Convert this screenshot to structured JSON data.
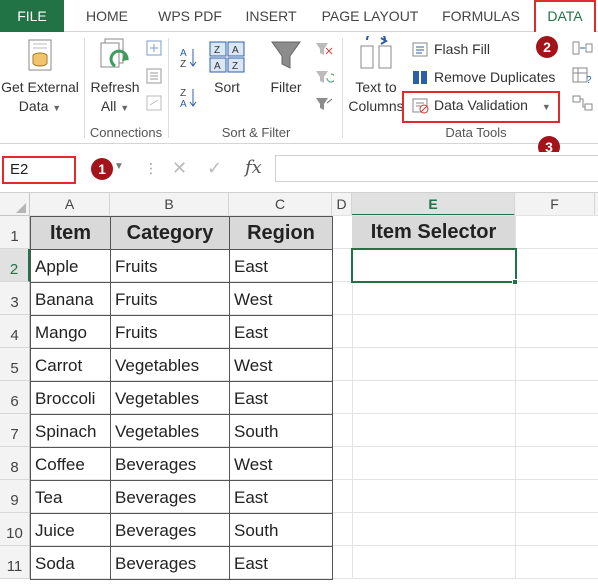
{
  "ribbon_tabs": [
    "FILE",
    "HOME",
    "WPS PDF",
    "INSERT",
    "PAGE LAYOUT",
    "FORMULAS",
    "DATA"
  ],
  "ribbon": {
    "get_external_data": {
      "line1": "Get External",
      "line2": "Data"
    },
    "refresh_all": {
      "line1": "Refresh",
      "line2": "All"
    },
    "connections_label": "Connections",
    "sort_label": "Sort",
    "filter_label": "Filter",
    "sort_filter_label": "Sort & Filter",
    "text_to_columns": {
      "line1": "Text to",
      "line2": "Columns"
    },
    "flash_fill": "Flash Fill",
    "remove_duplicates": "Remove Duplicates",
    "data_validation": "Data Validation",
    "data_tools_label": "Data Tools"
  },
  "markers": [
    "1",
    "2",
    "3"
  ],
  "formula_bar": {
    "name_box": "E2",
    "fx": "fx",
    "formula": ""
  },
  "colors": {
    "accent": "#217346",
    "highlight": "#e02b2b",
    "marker": "#a3141a"
  },
  "columns": [
    "A",
    "B",
    "C",
    "D",
    "E",
    "F"
  ],
  "active_column": "E",
  "active_row": "2",
  "rows": [
    "1",
    "2",
    "3",
    "4",
    "5",
    "6",
    "7",
    "8",
    "9",
    "10",
    "11"
  ],
  "table": {
    "headers": [
      "Item",
      "Category",
      "Region"
    ],
    "rows": [
      [
        "Apple",
        "Fruits",
        "East"
      ],
      [
        "Banana",
        "Fruits",
        "West"
      ],
      [
        "Mango",
        "Fruits",
        "East"
      ],
      [
        "Carrot",
        "Vegetables",
        "West"
      ],
      [
        "Broccoli",
        "Vegetables",
        "East"
      ],
      [
        "Spinach",
        "Vegetables",
        "South"
      ],
      [
        "Coffee",
        "Beverages",
        "West"
      ],
      [
        "Tea",
        "Beverages",
        "East"
      ],
      [
        "Juice",
        "Beverages",
        "South"
      ],
      [
        "Soda",
        "Beverages",
        "East"
      ]
    ]
  },
  "selector": {
    "header": "Item Selector",
    "value": ""
  }
}
